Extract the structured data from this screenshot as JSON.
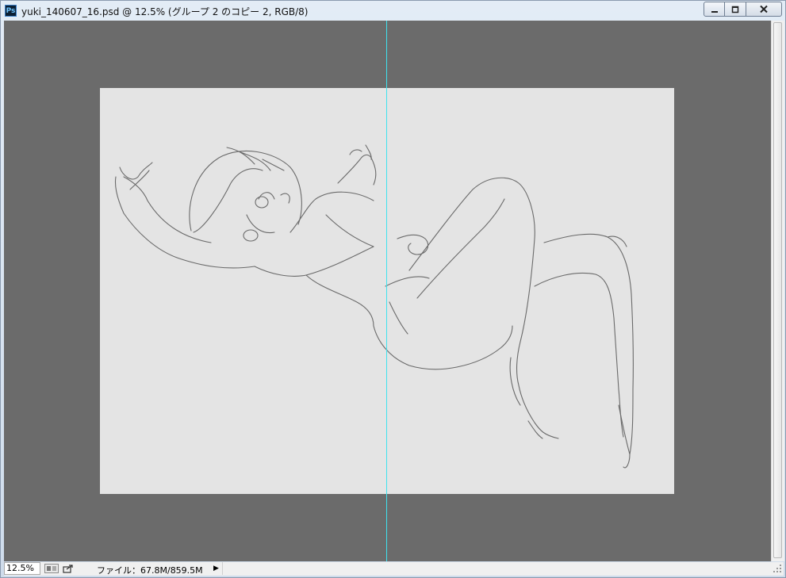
{
  "window": {
    "app_icon": "Ps",
    "title": "yuki_140607_16.psd @ 12.5% (グループ 2 のコピー 2, RGB/8)",
    "controls": {
      "minimize": "▁",
      "maximize": "□",
      "close": "✕"
    }
  },
  "status": {
    "zoom": "12.5%",
    "file_info": "ファイル：67.8M/859.5M",
    "menu_arrow": "▶"
  },
  "icons": {
    "app": "photoshop-icon",
    "share": "share-icon",
    "view": "view-toggle-icon",
    "grip": "resize-grip-icon"
  },
  "colors": {
    "workspace": "#6b6b6b",
    "document": "#e4e4e4",
    "guide": "#3fe2ef",
    "sketch_line": "#555555"
  }
}
